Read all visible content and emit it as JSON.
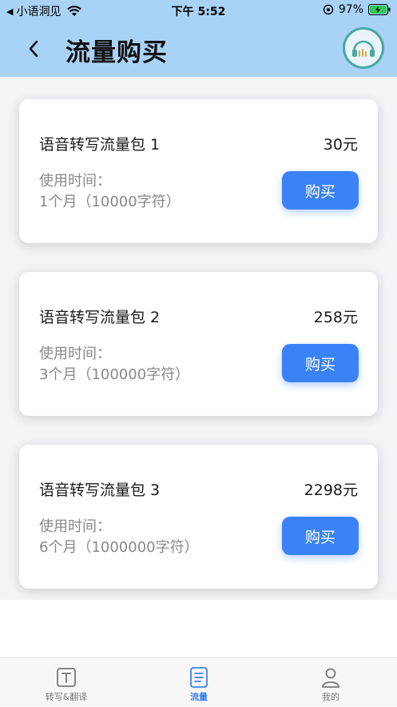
{
  "status_bar": {
    "back_app": "小语洞见",
    "time": "下午 5:52",
    "battery": "97%"
  },
  "header": {
    "title": "流量购买"
  },
  "packages": [
    {
      "name": "语音转写流量包 1",
      "price": "30元",
      "usage_label": "使用时间：",
      "usage_value": "1个月（10000字符）",
      "buy_label": "购买"
    },
    {
      "name": "语音转写流量包 2",
      "price": "258元",
      "usage_label": "使用时间：",
      "usage_value": "3个月（100000字符）",
      "buy_label": "购买"
    },
    {
      "name": "语音转写流量包 3",
      "price": "2298元",
      "usage_label": "使用时间：",
      "usage_value": "6个月（1000000字符）",
      "buy_label": "购买"
    }
  ],
  "tabs": [
    {
      "label": "转写&翻译",
      "icon": "text-box-icon",
      "active": false
    },
    {
      "label": "流量",
      "icon": "document-icon",
      "active": true
    },
    {
      "label": "我的",
      "icon": "person-icon",
      "active": false
    }
  ],
  "colors": {
    "header_bg": "#a9d3f6",
    "accent": "#3b82f6",
    "content_bg": "#f4f4f6"
  }
}
